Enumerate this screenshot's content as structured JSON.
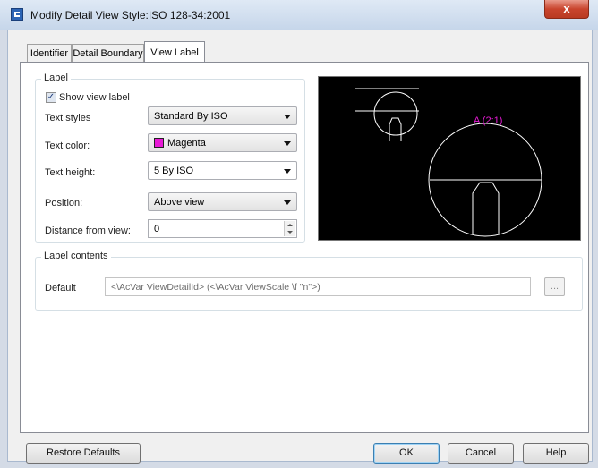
{
  "window": {
    "title": "Modify Detail View Style:ISO 128-34:2001",
    "close_label": "x"
  },
  "tabs": [
    {
      "label": "Identifier"
    },
    {
      "label": "Detail Boundary"
    },
    {
      "label": "View Label",
      "active": true
    }
  ],
  "label_group": {
    "title": "Label",
    "show_view_label": {
      "label": "Show view label",
      "checked": true,
      "mark": "✓"
    },
    "text_styles": {
      "label": "Text styles",
      "value": "Standard By ISO"
    },
    "text_color": {
      "label": "Text color:",
      "value": "Magenta",
      "swatch": "#e81ad6"
    },
    "text_height": {
      "label": "Text height:",
      "value": "5 By ISO"
    },
    "position": {
      "label": "Position:",
      "value": "Above view"
    },
    "distance": {
      "label": "Distance from view:",
      "value": "0"
    }
  },
  "preview": {
    "label_text": "A (2:1)",
    "label_color": "#e81ad6",
    "line_color": "#ffffff",
    "background": "#000000"
  },
  "label_contents": {
    "title": "Label contents",
    "default_label": "Default",
    "default_value": "<\\AcVar ViewDetailId> (<\\AcVar ViewScale \\f \"n\">)",
    "browse_label": "..."
  },
  "buttons": {
    "restore_defaults": "Restore Defaults",
    "ok": "OK",
    "cancel": "Cancel",
    "help": "Help"
  }
}
